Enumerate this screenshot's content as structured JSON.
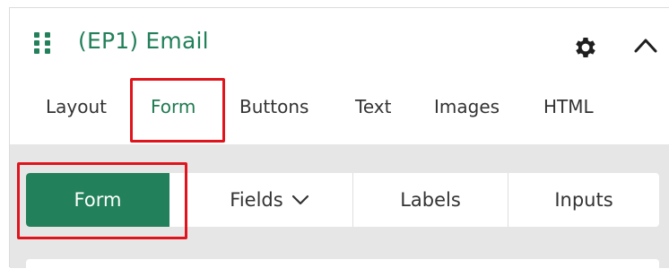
{
  "header": {
    "title": "(EP1) Email",
    "icons": {
      "drag": "drag-handle-icon",
      "settings": "gear-icon",
      "collapse": "chevron-up-icon"
    }
  },
  "tabs": [
    {
      "label": "Layout",
      "active": false
    },
    {
      "label": "Form",
      "active": true
    },
    {
      "label": "Buttons",
      "active": false
    },
    {
      "label": "Text",
      "active": false
    },
    {
      "label": "Images",
      "active": false
    },
    {
      "label": "HTML",
      "active": false
    }
  ],
  "subtabs": [
    {
      "label": "Form",
      "active": true
    },
    {
      "label": "Fields",
      "active": false,
      "has_dropdown": true
    },
    {
      "label": "Labels",
      "active": false
    },
    {
      "label": "Inputs",
      "active": false
    }
  ],
  "colors": {
    "accent": "#22805a",
    "highlight": "#e0141c",
    "background_gray": "#e6e6e6",
    "text": "#333333"
  }
}
